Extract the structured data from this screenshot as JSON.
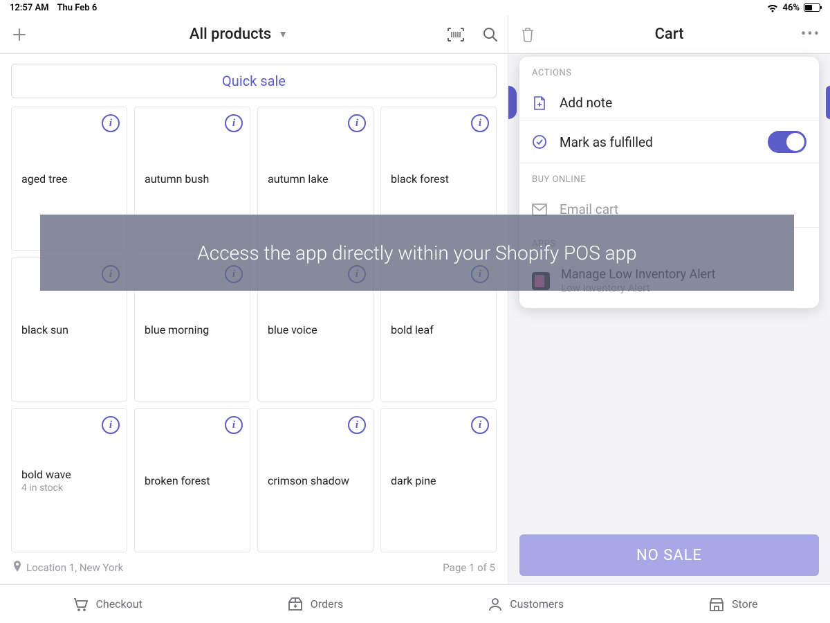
{
  "status": {
    "time": "12:57 AM",
    "date": "Thu Feb 6",
    "battery_pct": "46%"
  },
  "header": {
    "title": "All products",
    "cart_title": "Cart"
  },
  "quick_sale": "Quick sale",
  "products": [
    {
      "name": "aged tree"
    },
    {
      "name": "autumn bush"
    },
    {
      "name": "autumn lake"
    },
    {
      "name": "black forest"
    },
    {
      "name": "black sun"
    },
    {
      "name": "blue morning"
    },
    {
      "name": "blue voice"
    },
    {
      "name": "bold leaf"
    },
    {
      "name": "bold wave",
      "stock": "4 in stock"
    },
    {
      "name": "broken forest"
    },
    {
      "name": "crimson shadow"
    },
    {
      "name": "dark pine"
    }
  ],
  "left_footer": {
    "location": "Location 1, New York",
    "page": "Page 1 of 5"
  },
  "popover": {
    "section_actions": "ACTIONS",
    "add_note": "Add note",
    "mark_fulfilled": "Mark as fulfilled",
    "section_buy": "BUY ONLINE",
    "email_cart": "Email cart",
    "section_apps": "APPS",
    "app_title": "Manage Low Inventory Alert",
    "app_sub": "Low Inventory Alert"
  },
  "no_sale": "NO SALE",
  "overlay": "Access the app directly within your Shopify POS app",
  "tabs": {
    "checkout": "Checkout",
    "orders": "Orders",
    "customers": "Customers",
    "store": "Store"
  }
}
